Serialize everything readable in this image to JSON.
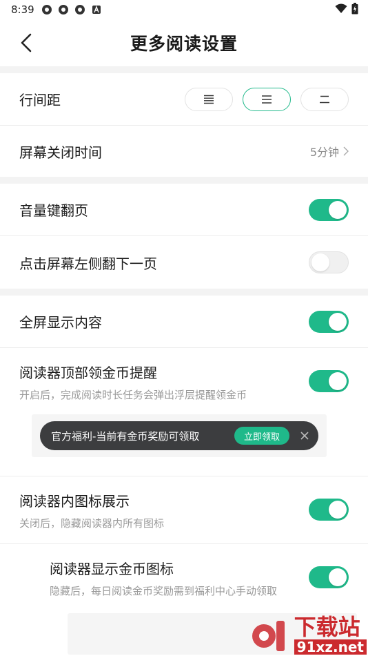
{
  "status_bar": {
    "time": "8:39"
  },
  "header": {
    "title": "更多阅读设置"
  },
  "line_spacing": {
    "label": "行间距",
    "selected_index": 1
  },
  "screen_off": {
    "label": "屏幕关闭时间",
    "value": "5分钟"
  },
  "volume_flip": {
    "label": "音量键翻页",
    "on": true
  },
  "tap_left_flip": {
    "label": "点击屏幕左侧翻下一页",
    "on": false
  },
  "fullscreen": {
    "label": "全屏显示内容",
    "on": true
  },
  "coin_reminder": {
    "label": "阅读器顶部领金币提醒",
    "desc": "开启后，完成阅读时长任务会弹出浮层提醒领金币",
    "on": true
  },
  "banner": {
    "text": "官方福利-当前有金币奖励可领取",
    "button": "立即领取"
  },
  "reader_icons": {
    "label": "阅读器内图标展示",
    "desc": "关闭后，隐藏阅读器内所有图标",
    "on": true
  },
  "coin_icon": {
    "label": "阅读器显示金币图标",
    "desc": "隐藏后，每日阅读金币奖励需到福利中心手动领取",
    "on": true
  },
  "watermark": {
    "big": "下载站",
    "small": "91xz.net"
  },
  "colors": {
    "accent": "#1fb98a",
    "banner_bg": "#3c3d3f"
  }
}
